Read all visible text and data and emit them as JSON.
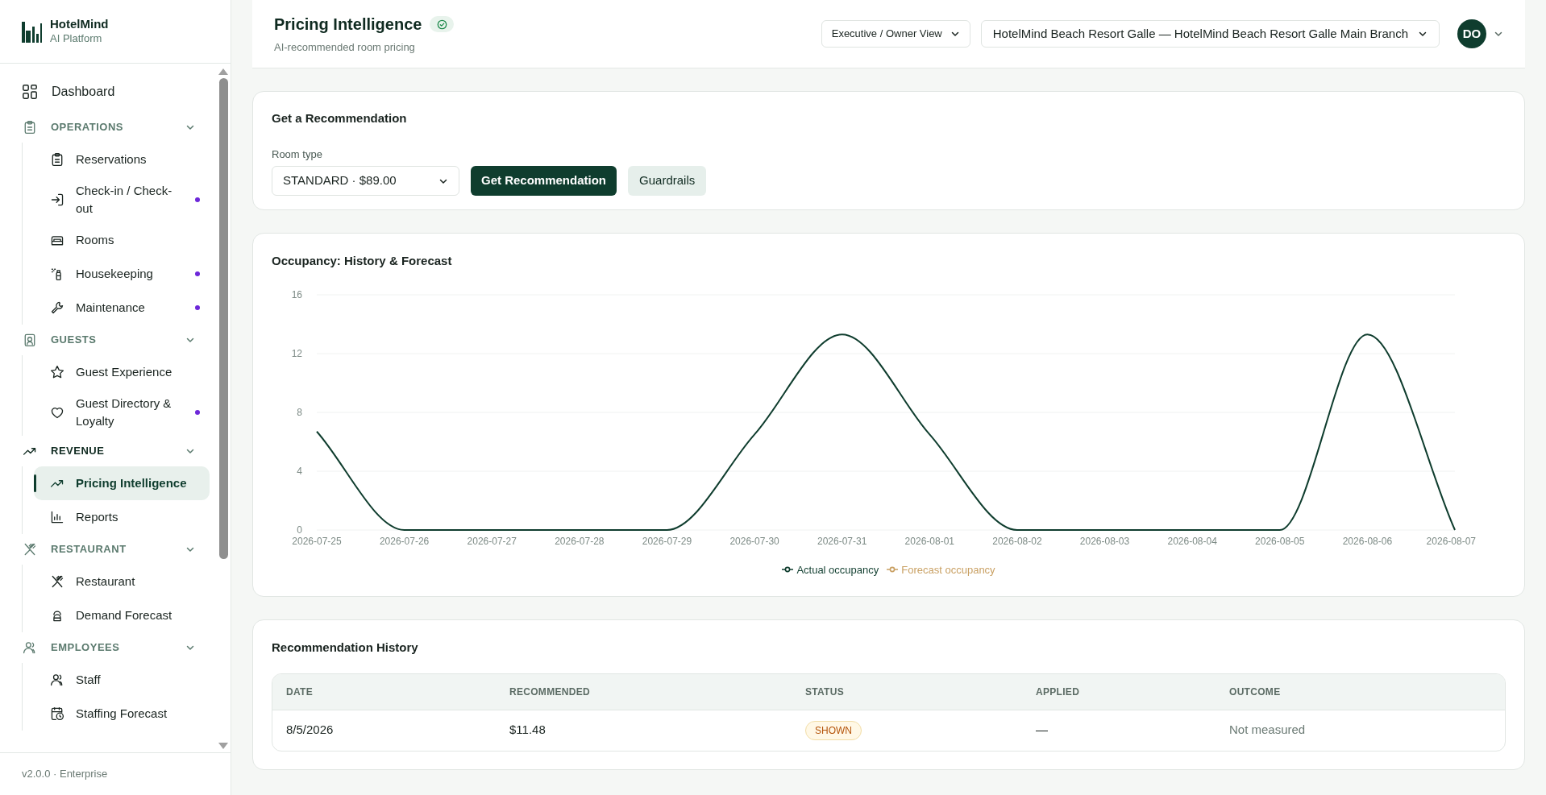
{
  "sidebar": {
    "brand": "HotelMind",
    "tagline": "AI Platform",
    "items": [
      {
        "kind": "link",
        "label": "Dashboard",
        "selected": false
      },
      {
        "kind": "section",
        "label": "OPERATIONS",
        "expanded": true,
        "selected": false,
        "children": [
          {
            "label": "Reservations",
            "selected": false,
            "dot": false
          },
          {
            "label": "Check-in / Check-out",
            "selected": false,
            "dot": true
          },
          {
            "label": "Rooms",
            "selected": false,
            "dot": false
          },
          {
            "label": "Housekeeping",
            "selected": false,
            "dot": true
          },
          {
            "label": "Maintenance",
            "selected": false,
            "dot": true
          }
        ]
      },
      {
        "kind": "section",
        "label": "GUESTS",
        "expanded": true,
        "selected": false,
        "children": [
          {
            "label": "Guest Experience",
            "selected": false,
            "dot": false
          },
          {
            "label": "Guest Directory & Loyalty",
            "selected": false,
            "dot": true
          }
        ]
      },
      {
        "kind": "section",
        "label": "REVENUE",
        "expanded": true,
        "selected": true,
        "children": [
          {
            "label": "Pricing Intelligence",
            "selected": true,
            "dot": false
          },
          {
            "label": "Reports",
            "selected": false,
            "dot": false
          }
        ]
      },
      {
        "kind": "section",
        "label": "RESTAURANT",
        "expanded": true,
        "selected": false,
        "children": [
          {
            "label": "Restaurant",
            "selected": false,
            "dot": false
          },
          {
            "label": "Demand Forecast",
            "selected": false,
            "dot": false
          }
        ]
      },
      {
        "kind": "section",
        "label": "EMPLOYEES",
        "expanded": true,
        "selected": false,
        "children": [
          {
            "label": "Staff",
            "selected": false,
            "dot": false
          },
          {
            "label": "Staffing Forecast",
            "selected": false,
            "dot": false
          }
        ]
      }
    ],
    "footer": "v2.0.0 · Enterprise"
  },
  "header": {
    "title": "Pricing Intelligence",
    "verified": true,
    "subtitle": "AI-recommended room pricing",
    "view": "Executive / Owner View",
    "property": "HotelMind Beach Resort Galle — HotelMind Beach Resort Galle Main Branch",
    "avatar": "DO"
  },
  "recommendation": {
    "title": "Get a Recommendation",
    "field_label": "Room type",
    "room_type": "STANDARD · $89.00",
    "primary_button": "Get Recommendation",
    "secondary_button": "Guardrails"
  },
  "occupancy": {
    "title": "Occupancy: History & Forecast",
    "chart_data": {
      "type": "line",
      "categories": [
        "2026-07-25",
        "2026-07-26",
        "2026-07-27",
        "2026-07-28",
        "2026-07-29",
        "2026-07-30",
        "2026-07-31",
        "2026-08-01",
        "2026-08-02",
        "2026-08-03",
        "2026-08-04",
        "2026-08-05",
        "2026-08-06",
        "2026-08-07"
      ],
      "series": [
        {
          "name": "Actual occupancy",
          "color": "#0f3d2e",
          "values": [
            6.7,
            0,
            0,
            0,
            0,
            6.5,
            13.3,
            6.5,
            0,
            0,
            0,
            0,
            13.3,
            0
          ]
        },
        {
          "name": "Forecast occupancy",
          "color": "#c9a063",
          "values": [
            null,
            null,
            null,
            null,
            null,
            null,
            null,
            null,
            null,
            null,
            null,
            null,
            null,
            null
          ]
        }
      ],
      "ylim": [
        0,
        16
      ],
      "yticks": [
        0,
        4,
        8,
        12,
        16
      ],
      "grid": true
    }
  },
  "history": {
    "title": "Recommendation History",
    "columns": [
      "DATE",
      "RECOMMENDED",
      "STATUS",
      "APPLIED",
      "OUTCOME"
    ],
    "rows": [
      {
        "date": "8/5/2026",
        "recommended": "$11.48",
        "status": "SHOWN",
        "applied": "—",
        "outcome": "Not measured"
      }
    ]
  }
}
